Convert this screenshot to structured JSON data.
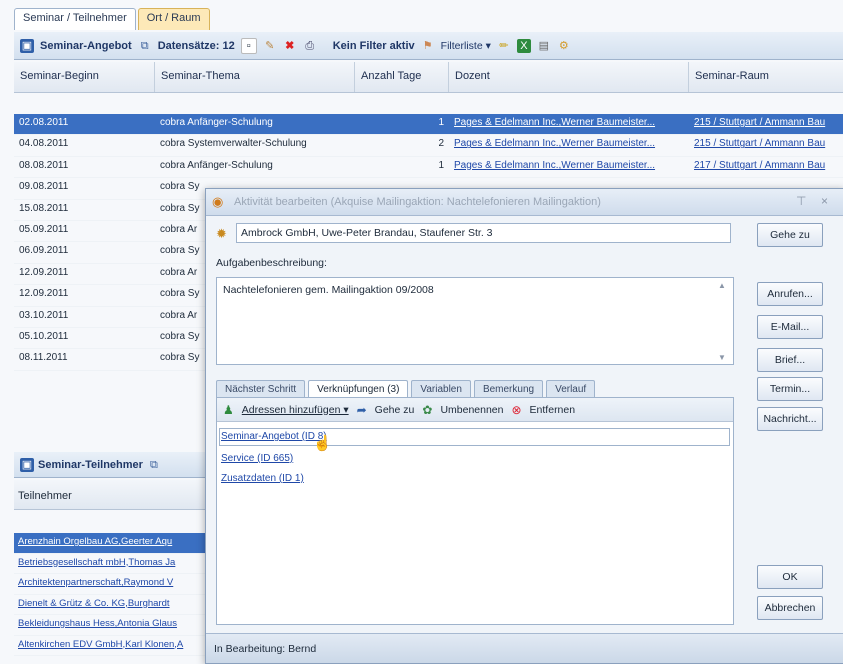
{
  "top_tabs": [
    "Seminar / Teilnehmer",
    "Ort / Raum"
  ],
  "toolbar": {
    "title": "Seminar-Angebot",
    "records": "Datensätze: 12",
    "filter": "Kein Filter aktiv",
    "filterlist": "Filterliste ▾"
  },
  "grid": {
    "headers": [
      "Seminar-Beginn",
      "Seminar-Thema",
      "Anzahl Tage",
      "Dozent",
      "Seminar-Raum"
    ],
    "rows": [
      {
        "date": "02.08.2011",
        "topic": "cobra Anfänger-Schulung",
        "days": "1",
        "teacher": "Pages & Edelmann Inc.,Werner Baumeister...",
        "room": "215 / Stuttgart / Ammann Bau"
      },
      {
        "date": "04.08.2011",
        "topic": "cobra Systemverwalter-Schulung",
        "days": "2",
        "teacher": "Pages & Edelmann Inc.,Werner Baumeister...",
        "room": "215 / Stuttgart / Ammann Bau"
      },
      {
        "date": "08.08.2011",
        "topic": "cobra Anfänger-Schulung",
        "days": "1",
        "teacher": "Pages & Edelmann Inc.,Werner Baumeister...",
        "room": "217 / Stuttgart / Ammann Bau"
      },
      {
        "date": "09.08.2011",
        "topic": "cobra Sy",
        "days": "",
        "teacher": "",
        "room": ""
      },
      {
        "date": "15.08.2011",
        "topic": "cobra Sy",
        "days": "",
        "teacher": "",
        "room": ""
      },
      {
        "date": "05.09.2011",
        "topic": "cobra Ar",
        "days": "",
        "teacher": "",
        "room": ""
      },
      {
        "date": "06.09.2011",
        "topic": "cobra Sy",
        "days": "",
        "teacher": "",
        "room": ""
      },
      {
        "date": "12.09.2011",
        "topic": "cobra Ar",
        "days": "",
        "teacher": "",
        "room": ""
      },
      {
        "date": "12.09.2011",
        "topic": "cobra Sy",
        "days": "",
        "teacher": "",
        "room": ""
      },
      {
        "date": "03.10.2011",
        "topic": "cobra Ar",
        "days": "",
        "teacher": "",
        "room": ""
      },
      {
        "date": "05.10.2011",
        "topic": "cobra Sy",
        "days": "",
        "teacher": "",
        "room": ""
      },
      {
        "date": "08.11.2011",
        "topic": "cobra Sy",
        "days": "",
        "teacher": "",
        "room": ""
      }
    ]
  },
  "participants": {
    "toolbar_title": "Seminar-Teilnehmer",
    "header": "Teilnehmer",
    "rows": [
      "Arenzhain Orgelbau AG,Geerter Aqu",
      "Betriebsgesellschaft mbH,Thomas Ja",
      "Architektenpartnerschaft,Raymond V",
      "Dienelt & Grütz & Co. KG,Burghardt",
      "Bekleidungshaus Hess,Antonia Glaus",
      "Altenkirchen EDV GmbH,Karl Klonen,A"
    ]
  },
  "dialog": {
    "title": "Aktivität bearbeiten (Akquise Mailingaktion: Nachtelefonieren Mailingaktion)",
    "address": "Ambrock GmbH, Uwe-Peter Brandau, Staufener Str. 3",
    "desc_label": "Aufgabenbeschreibung:",
    "desc_text": "Nachtelefonieren gem. Mailingaktion 09/2008",
    "buttons": {
      "goto": "Gehe zu",
      "call": "Anrufen...",
      "email": "E-Mail...",
      "letter": "Brief...",
      "appointment": "Termin...",
      "message": "Nachricht...",
      "ok": "OK",
      "cancel": "Abbrechen"
    },
    "tabs": [
      "Nächster Schritt",
      "Verknüpfungen (3)",
      "Variablen",
      "Bemerkung",
      "Verlauf"
    ],
    "links_toolbar": {
      "add": "Adressen hinzufügen ▾",
      "goto": "Gehe zu",
      "rename": "Umbenennen",
      "remove": "Entfernen"
    },
    "links": [
      "Seminar-Angebot (ID 8)",
      "Service (ID 665)",
      "Zusatzdaten (ID 1)"
    ],
    "status": "In Bearbeitung: Bernd"
  }
}
